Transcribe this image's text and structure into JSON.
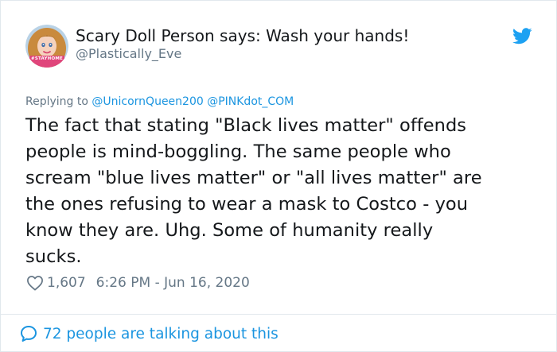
{
  "tweet": {
    "author_name": "Scary Doll Person says: Wash your hands!",
    "author_handle": "@Plastically_Eve",
    "avatar_caption": "#STAYHOME",
    "reply_prefix": "Replying to",
    "reply_mentions": "@UnicornQueen200 @PINKdot_COM",
    "text": "The fact that stating \"Black lives matter\" offends\npeople is mind-boggling.  The same people who\nscream \"blue lives matter\" or \"all lives matter\" are\nthe ones refusing to wear a mask to Costco - you\nknow they are.  Uhg.  Some of humanity really\nsucks.",
    "likes": "1,607",
    "timestamp": "6:26 PM - Jun 16, 2020",
    "conversation_link": "72 people are talking about this"
  },
  "icons": {
    "brand": "twitter-bird-icon",
    "like": "heart-icon",
    "conversation": "speech-bubble-icon"
  },
  "colors": {
    "accent": "#1b95e0",
    "text_primary": "#14171a",
    "text_secondary": "#657786",
    "border": "#e1e8ed",
    "avatar_badge": "#e0457b"
  }
}
